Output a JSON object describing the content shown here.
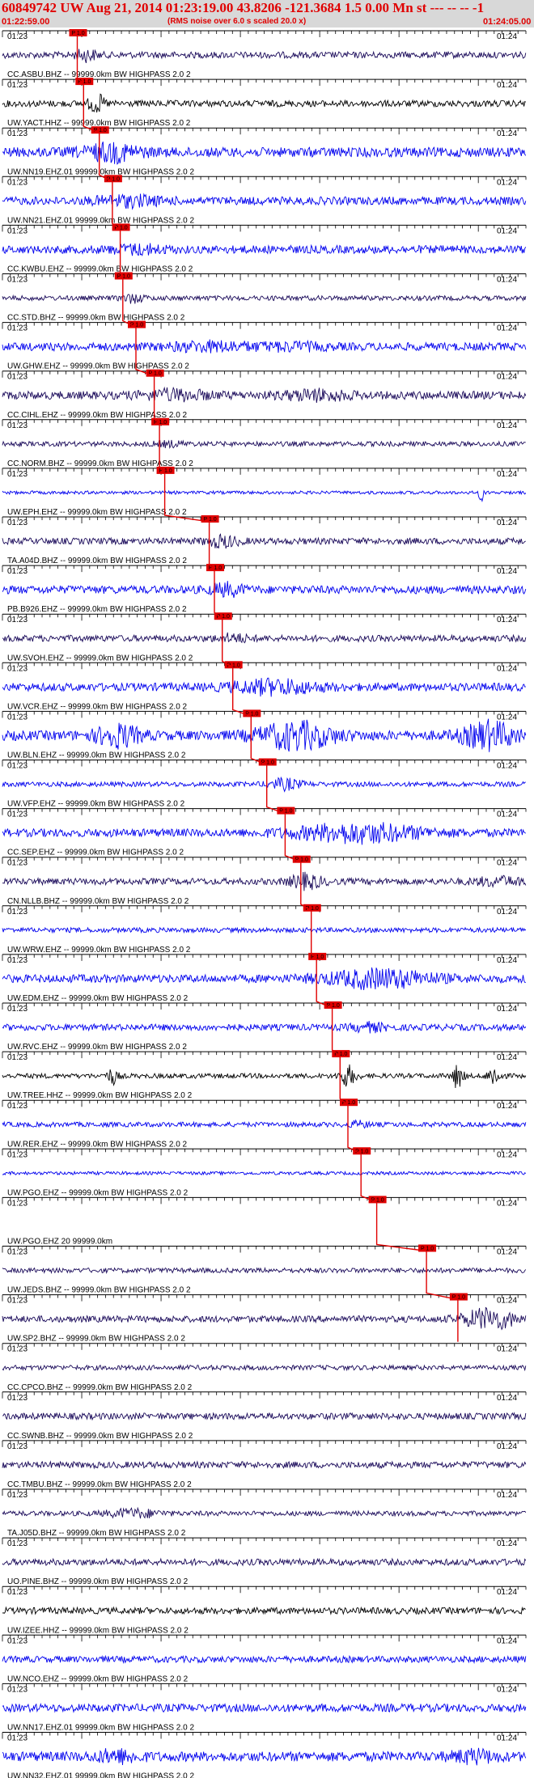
{
  "header": {
    "title": "60849742 UW Aug 21, 2014 01:23:19.00   43.8206 -121.3684  1.5 0.00 Mn st --- -- --   -1",
    "start_time": "01:22:59.00",
    "note": "(RMS noise over 6.0 s scaled 20.0 x)",
    "end_time": "01:24:05.00"
  },
  "pick_label": "P 1.0",
  "tick_labels": {
    "left": "01:23",
    "right": "01:24"
  },
  "colors": {
    "header_bg": "#d8d8d8",
    "header_text": "#e00000",
    "pick": "#e00000",
    "trace_blue": "#0000ee",
    "trace_navy": "#1a0a5a",
    "trace_black": "#000000",
    "timeline": "#000000"
  },
  "traces": [
    {
      "label": "CC.ASBU.BHZ -- 99999.0km BW  HIGHPASS  2.0  2",
      "color": "navy",
      "amp": 4,
      "pick": 0.143,
      "bursts": [
        [
          0.16,
          0.02,
          2.5
        ]
      ]
    },
    {
      "label": "UW.YACT.HHZ -- 99999.0km BW  HIGHPASS  2.0  2",
      "color": "black",
      "amp": 4,
      "pick": 0.155,
      "bursts": [
        [
          0.18,
          0.015,
          3.5
        ]
      ]
    },
    {
      "label": "UW.NN19.EHZ.01 99999.0km BW  HIGHPASS  2.0  2",
      "color": "blue",
      "amp": 6,
      "pick": 0.185,
      "bursts": [
        [
          0.21,
          0.05,
          2.5
        ]
      ]
    },
    {
      "label": "UW.NN21.EHZ.01 99999.0km BW  HIGHPASS  2.0  2",
      "color": "blue",
      "amp": 5,
      "pick": 0.21,
      "bursts": [
        [
          0.24,
          0.06,
          2
        ]
      ]
    },
    {
      "label": "CC.KWBU.EHZ -- 99999.0km BW  HIGHPASS  2.0  2",
      "color": "blue",
      "amp": 5,
      "pick": 0.225,
      "bursts": [
        [
          0.26,
          0.05,
          1.8
        ]
      ]
    },
    {
      "label": "CC.STD.BHZ -- 99999.0km BW  HIGHPASS  2.0  2",
      "color": "navy",
      "amp": 3,
      "pick": 0.23,
      "bursts": [
        [
          0.25,
          0.02,
          2.5
        ]
      ]
    },
    {
      "label": "UW.GHW.EHZ -- 99999.0km BW  HIGHPASS  2.0  2",
      "color": "blue",
      "amp": 5,
      "pick": 0.255,
      "bursts": [
        [
          0.4,
          0.08,
          1.8
        ],
        [
          0.55,
          0.06,
          1.6
        ]
      ]
    },
    {
      "label": "CC.CIHL.EHZ -- 99999.0km BW  HIGHPASS  2.0  2",
      "color": "navy",
      "amp": 5,
      "pick": 0.29,
      "bursts": [
        [
          0.33,
          0.06,
          2
        ],
        [
          0.6,
          0.06,
          2
        ]
      ]
    },
    {
      "label": "CC.NORM.BHZ -- 99999.0km BW  HIGHPASS  2.0  2",
      "color": "navy",
      "amp": 3,
      "pick": 0.3,
      "bursts": [
        [
          0.32,
          0.03,
          1.8
        ]
      ]
    },
    {
      "label": "UW.EPH.EHZ -- 99999.0km BW  HIGHPASS  2.0  2",
      "color": "blue",
      "amp": 2,
      "pick": 0.31,
      "bursts": [
        [
          0.915,
          0.005,
          6
        ]
      ]
    },
    {
      "label": "TA.A04D.BHZ -- 99999.0km BW  HIGHPASS  2.0  2",
      "color": "navy",
      "amp": 4,
      "pick": 0.395,
      "bursts": [
        [
          0.42,
          0.03,
          2.5
        ]
      ]
    },
    {
      "label": "PB.B926.EHZ -- 99999.0km BW  HIGHPASS  2.0  2",
      "color": "blue",
      "amp": 5,
      "pick": 0.405,
      "bursts": [
        [
          0.43,
          0.03,
          2.2
        ]
      ]
    },
    {
      "label": "UW.SVOH.EHZ -- 99999.0km BW  HIGHPASS  2.0  2",
      "color": "navy",
      "amp": 4,
      "pick": 0.42,
      "bursts": [
        [
          0.44,
          0.03,
          2
        ]
      ]
    },
    {
      "label": "UW.VCR.EHZ -- 99999.0km BW  HIGHPASS  2.0  2",
      "color": "blue",
      "amp": 5,
      "pick": 0.44,
      "bursts": [
        [
          0.52,
          0.08,
          2.5
        ]
      ]
    },
    {
      "label": "UW.BLN.EHZ -- 99999.0km BW  HIGHPASS  2.0  2",
      "color": "blue",
      "amp": 6,
      "pick": 0.475,
      "bursts": [
        [
          0.22,
          0.04,
          3
        ],
        [
          0.56,
          0.07,
          3.5
        ],
        [
          0.93,
          0.05,
          3.5
        ]
      ]
    },
    {
      "label": "UW.VFP.EHZ -- 99999.0km BW  HIGHPASS  2.0  2",
      "color": "blue",
      "amp": 3,
      "pick": 0.505,
      "bursts": [
        [
          0.54,
          0.03,
          3
        ]
      ]
    },
    {
      "label": "CC.SEP.EHZ -- 99999.0km BW  HIGHPASS  2.0  2",
      "color": "blue",
      "amp": 5,
      "pick": 0.54,
      "bursts": [
        [
          0.68,
          0.12,
          3
        ]
      ]
    },
    {
      "label": "CN.NLLB.BHZ -- 99999.0km BW  HIGHPASS  2.0  2",
      "color": "navy",
      "amp": 4,
      "pick": 0.57,
      "bursts": [
        [
          0.58,
          0.03,
          3
        ],
        [
          0.95,
          0.05,
          2
        ]
      ]
    },
    {
      "label": "UW.WRW.EHZ -- 99999.0km BW  HIGHPASS  2.0  2",
      "color": "blue",
      "amp": 3,
      "pick": 0.59,
      "bursts": []
    },
    {
      "label": "UW.EDM.EHZ -- 99999.0km BW  HIGHPASS  2.0  2",
      "color": "blue",
      "amp": 5,
      "pick": 0.6,
      "bursts": [
        [
          0.72,
          0.1,
          3
        ]
      ]
    },
    {
      "label": "UW.RVC.EHZ -- 99999.0km BW  HIGHPASS  2.0  2",
      "color": "blue",
      "amp": 4,
      "pick": 0.63,
      "bursts": [
        [
          0.7,
          0.03,
          2
        ]
      ]
    },
    {
      "label": "UW.TREE.HHZ -- 99999.0km BW  HIGHPASS  2.0  2",
      "color": "black",
      "amp": 3,
      "pick": 0.645,
      "bursts": [
        [
          0.21,
          0.01,
          4
        ],
        [
          0.66,
          0.015,
          5
        ],
        [
          0.87,
          0.01,
          6
        ],
        [
          0.94,
          0.012,
          5
        ]
      ]
    },
    {
      "label": "UW.RER.EHZ -- 99999.0km BW  HIGHPASS  2.0  2",
      "color": "blue",
      "amp": 3,
      "pick": 0.66,
      "bursts": [
        [
          0.68,
          0.02,
          2
        ]
      ]
    },
    {
      "label": "UW.PGO.EHZ -- 99999.0km BW  HIGHPASS  2.0  2",
      "color": "blue",
      "amp": 2,
      "pick": 0.685,
      "bursts": []
    },
    {
      "label": "UW.PGO.EHZ 20 99999.0km",
      "color": "blue",
      "amp": 0,
      "pick": 0.715,
      "bursts": []
    },
    {
      "label": "UW.JEDS.BHZ -- 99999.0km BW  HIGHPASS  2.0  2",
      "color": "navy",
      "amp": 3,
      "pick": 0.81,
      "bursts": []
    },
    {
      "label": "UW.SP2.BHZ -- 99999.0km BW  HIGHPASS  2.0  2",
      "color": "navy",
      "amp": 4,
      "pick": 0.87,
      "bursts": [
        [
          0.93,
          0.05,
          4
        ]
      ]
    },
    {
      "label": "CC.CPCO.BHZ -- 99999.0km BW  HIGHPASS  2.0  2",
      "color": "navy",
      "amp": 3,
      "pick": null,
      "bursts": []
    },
    {
      "label": "CC.SWNB.BHZ -- 99999.0km BW  HIGHPASS  2.0  2",
      "color": "navy",
      "amp": 4,
      "pick": null,
      "bursts": []
    },
    {
      "label": "CC.TMBU.BHZ -- 99999.0km BW  HIGHPASS  2.0  2",
      "color": "navy",
      "amp": 4,
      "pick": null,
      "bursts": []
    },
    {
      "label": "TA.J05D.BHZ -- 99999.0km BW  HIGHPASS  2.0  2",
      "color": "navy",
      "amp": 3,
      "pick": null,
      "bursts": [
        [
          0.25,
          0.05,
          2.5
        ]
      ]
    },
    {
      "label": "UO.PINE.BHZ -- 99999.0km BW  HIGHPASS  2.0  2",
      "color": "navy",
      "amp": 4,
      "pick": null,
      "bursts": []
    },
    {
      "label": "UW.IZEE.HHZ -- 99999.0km BW  HIGHPASS  2.0  2",
      "color": "black",
      "amp": 4,
      "pick": null,
      "bursts": []
    },
    {
      "label": "UW.NCO.EHZ -- 99999.0km BW  HIGHPASS  2.0  2",
      "color": "blue",
      "amp": 4,
      "pick": null,
      "bursts": []
    },
    {
      "label": "UW.NN17.EHZ.01 99999.0km BW  HIGHPASS  2.0  2",
      "color": "blue",
      "amp": 5,
      "pick": null,
      "bursts": []
    },
    {
      "label": "UW.NN32.EHZ.01 99999.0km BW  HIGHPASS  2.0  2",
      "color": "blue",
      "amp": 6,
      "pick": null,
      "bursts": [
        [
          0.22,
          0.04,
          2
        ],
        [
          0.9,
          0.04,
          2
        ]
      ]
    }
  ]
}
